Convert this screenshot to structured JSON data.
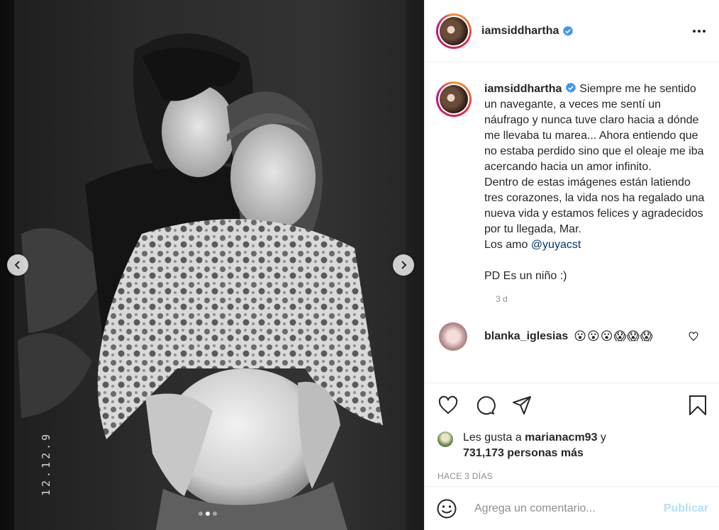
{
  "post": {
    "username": "iamsiddhartha",
    "verified": true,
    "photo_date_stamp": "12.12.9",
    "carousel": {
      "total": 3,
      "active_index": 1
    }
  },
  "caption": {
    "body": "Siempre me he sentido un navegante, a veces me sentí un náufrago y nunca tuve claro hacia a dónde me llevaba tu marea... Ahora entiendo que no estaba perdido sino que el oleaje me iba acercando hacia un amor infinito.\nDentro de estas imágenes están latiendo tres corazones, la vida nos ha regalado una nueva vida y estamos felices y agradecidos por tu llegada, Mar.\nLos amo ",
    "mention": "@yuyacst",
    "postscript": "\n\nPD Es un niño :)",
    "time": "3 d"
  },
  "first_comment": {
    "username": "blanka_iglesias",
    "text": "😮😮😮😱😱😱"
  },
  "likes": {
    "prefix": "Les gusta a ",
    "user": "marianacm93",
    "connector": " y",
    "count_text": "731,173 personas más"
  },
  "timestamp": "HACE 3 DÍAS",
  "comment_box": {
    "placeholder": "Agrega un comentario...",
    "publish_label": "Publicar"
  },
  "colors": {
    "accent_link": "#00376b",
    "verified_blue": "#3897f0",
    "publish_disabled": "#b2dffc",
    "secondary_text": "#8e8e8e"
  },
  "icons": [
    "chevron-left-icon",
    "chevron-right-icon",
    "verified-badge-icon",
    "more-options-icon",
    "heart-icon",
    "comment-icon",
    "share-icon",
    "bookmark-icon",
    "emoji-icon"
  ]
}
